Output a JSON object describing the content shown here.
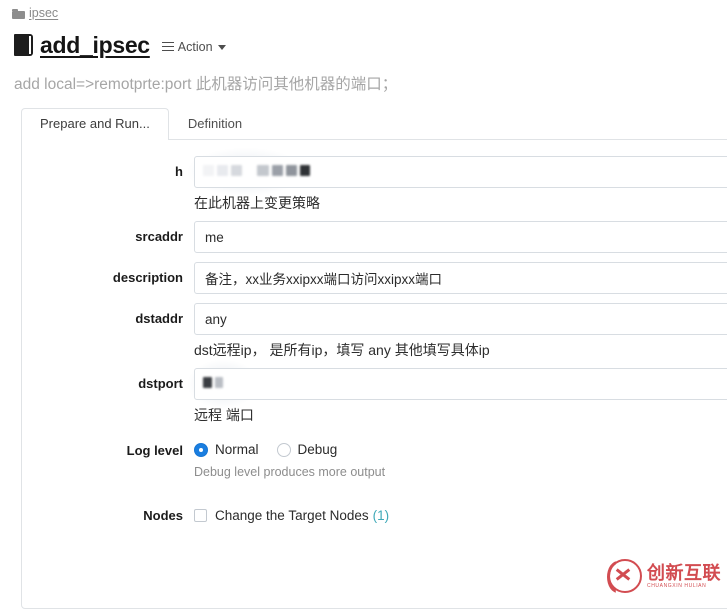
{
  "breadcrumb": {
    "icon": "folder-icon",
    "label": "ipsec"
  },
  "header": {
    "icon": "book-icon",
    "title": "add_ipsec",
    "action_menu": {
      "icon": "list-icon",
      "label": "Action",
      "caret": "chevron-down-icon"
    }
  },
  "subtitle": "add local=>remotprte:port 此机器访问其他机器的端口；",
  "tabs": [
    {
      "label": "Prepare and Run...",
      "active": true
    },
    {
      "label": "Definition",
      "active": false
    }
  ],
  "form": {
    "fields": [
      {
        "label": "h",
        "type": "text-redacted",
        "value": "",
        "placeholder": "",
        "help": "在此机器上变更策略",
        "help_muted": false
      },
      {
        "label": "srcaddr",
        "type": "text",
        "value": "me",
        "placeholder": "",
        "help": "",
        "help_muted": false
      },
      {
        "label": "description",
        "type": "text",
        "value": "备注，xx业务xxipxx端口访问xxipxx端口",
        "placeholder": "",
        "help": "",
        "help_muted": false
      },
      {
        "label": "dstaddr",
        "type": "text",
        "value": "any",
        "placeholder": "",
        "help": "dst远程ip， 是所有ip，填写 any 其他填写具体ip",
        "help_muted": false
      },
      {
        "label": "dstport",
        "type": "text-redacted-small",
        "value": "",
        "placeholder": "",
        "help": "远程 端口",
        "help_muted": false
      }
    ],
    "log_level": {
      "label": "Log level",
      "options": [
        {
          "label": "Normal",
          "selected": true
        },
        {
          "label": "Debug",
          "selected": false
        }
      ],
      "help": "Debug level produces more output"
    },
    "nodes": {
      "label": "Nodes",
      "checkbox_label": "Change the Target Nodes",
      "count": "(1)",
      "checked": false
    }
  },
  "watermark": {
    "cn": "创新互联",
    "en": "CHUANGXIN  HULIAN"
  },
  "colors": {
    "accent_blue": "#1a7ee0",
    "link_teal": "#3fa9b8",
    "watermark_red": "#c9262c",
    "border": "#e0e3e6",
    "input_border": "#d8dde2",
    "subtitle_gray": "#a6a6a6"
  }
}
